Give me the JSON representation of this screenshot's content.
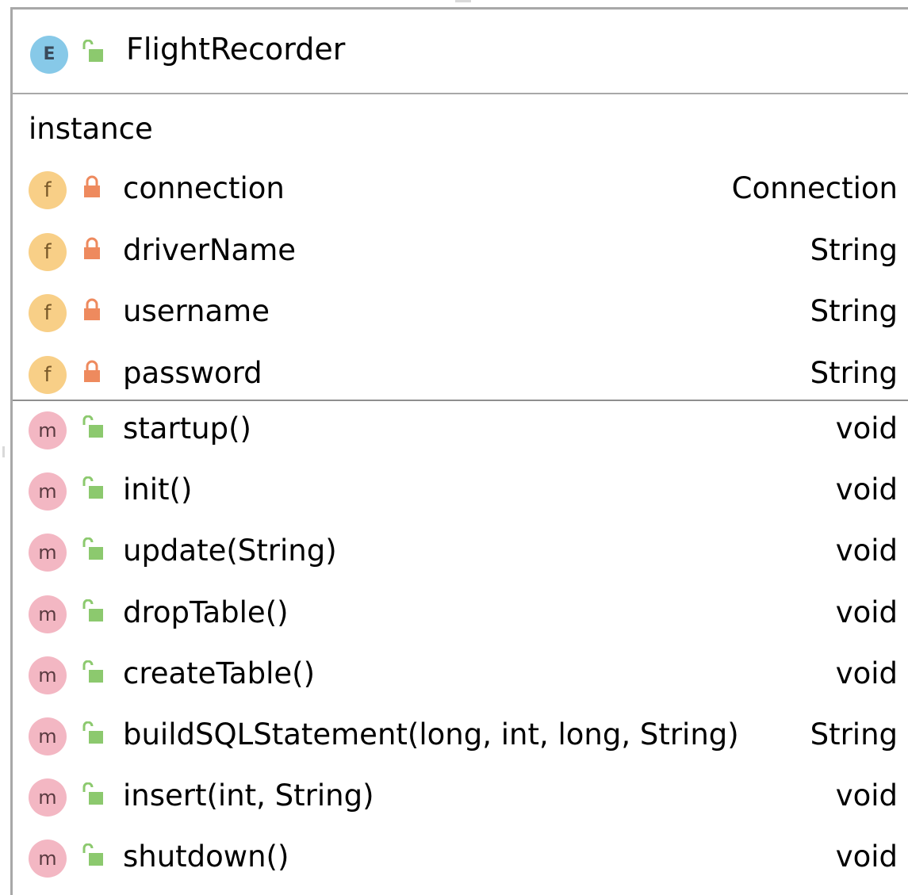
{
  "class": {
    "kind_letter": "E",
    "name": "FlightRecorder",
    "visibility": "public"
  },
  "fields_group_label": "instance",
  "fields": [
    {
      "kind_letter": "f",
      "visibility": "private",
      "name": "connection",
      "type": "Connection"
    },
    {
      "kind_letter": "f",
      "visibility": "private",
      "name": "driverName",
      "type": "String"
    },
    {
      "kind_letter": "f",
      "visibility": "private",
      "name": "username",
      "type": "String"
    },
    {
      "kind_letter": "f",
      "visibility": "private",
      "name": "password",
      "type": "String"
    }
  ],
  "methods": [
    {
      "kind_letter": "m",
      "visibility": "public",
      "name": "startup()",
      "type": "void"
    },
    {
      "kind_letter": "m",
      "visibility": "public",
      "name": "init()",
      "type": "void"
    },
    {
      "kind_letter": "m",
      "visibility": "public",
      "name": "update(String)",
      "type": "void"
    },
    {
      "kind_letter": "m",
      "visibility": "public",
      "name": "dropTable()",
      "type": "void"
    },
    {
      "kind_letter": "m",
      "visibility": "public",
      "name": "createTable()",
      "type": "void"
    },
    {
      "kind_letter": "m",
      "visibility": "public",
      "name": "buildSQLStatement(long, int, long, String)",
      "type": "String"
    },
    {
      "kind_letter": "m",
      "visibility": "public",
      "name": "insert(int, String)",
      "type": "void"
    },
    {
      "kind_letter": "m",
      "visibility": "public",
      "name": "shutdown()",
      "type": "void"
    }
  ],
  "colors": {
    "enum_badge": "#87c9e8",
    "field_badge": "#f8cf87",
    "method_badge": "#f3b7c3",
    "public_lock": "#8cc96e",
    "private_lock": "#ee8a5e",
    "border": "#a8a8a8"
  }
}
